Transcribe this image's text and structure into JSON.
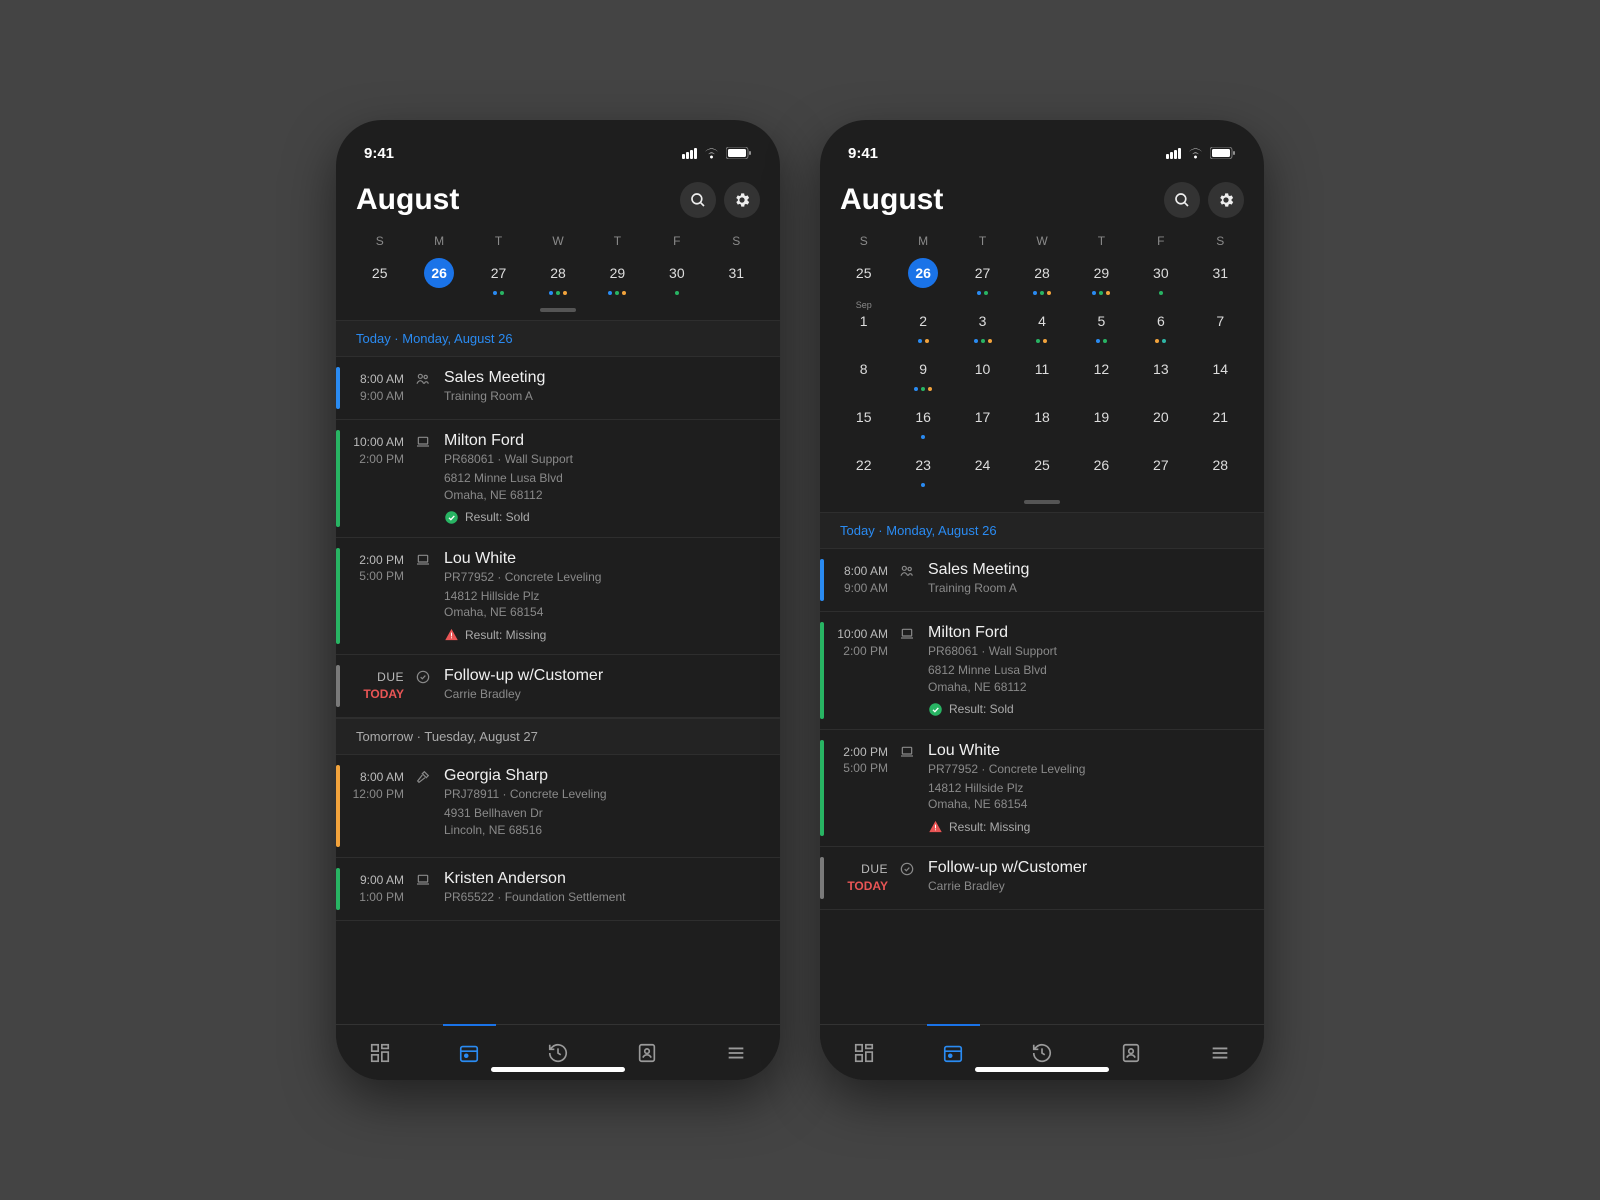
{
  "status": {
    "time": "9:41"
  },
  "header": {
    "title": "August"
  },
  "weekdays": [
    "S",
    "M",
    "T",
    "W",
    "T",
    "F",
    "S"
  ],
  "colors": {
    "blue": "#2a8bf2",
    "green": "#28b463",
    "orange": "#f2a33c",
    "teal": "#2fb6a6",
    "red": "#e95555",
    "gray": "#7a7a7a"
  },
  "weeks_left": [
    {
      "days": [
        {
          "n": "25"
        },
        {
          "n": "26",
          "selected": true
        },
        {
          "n": "27",
          "dots": [
            "blue",
            "green"
          ]
        },
        {
          "n": "28",
          "dots": [
            "blue",
            "green",
            "orange"
          ]
        },
        {
          "n": "29",
          "dots": [
            "blue",
            "green",
            "orange"
          ]
        },
        {
          "n": "30",
          "dots": [
            "green"
          ]
        },
        {
          "n": "31"
        }
      ]
    }
  ],
  "weeks_right": [
    {
      "days": [
        {
          "n": "25"
        },
        {
          "n": "26",
          "selected": true
        },
        {
          "n": "27",
          "dots": [
            "blue",
            "green"
          ]
        },
        {
          "n": "28",
          "dots": [
            "blue",
            "green",
            "orange"
          ]
        },
        {
          "n": "29",
          "dots": [
            "blue",
            "green",
            "orange"
          ]
        },
        {
          "n": "30",
          "dots": [
            "green"
          ]
        },
        {
          "n": "31"
        }
      ]
    },
    {
      "days": [
        {
          "n": "1",
          "month_label": "Sep"
        },
        {
          "n": "2",
          "dots": [
            "blue",
            "orange"
          ]
        },
        {
          "n": "3",
          "dots": [
            "blue",
            "green",
            "orange"
          ]
        },
        {
          "n": "4",
          "dots": [
            "green",
            "orange"
          ]
        },
        {
          "n": "5",
          "dots": [
            "blue",
            "green"
          ]
        },
        {
          "n": "6",
          "dots": [
            "orange",
            "teal"
          ]
        },
        {
          "n": "7"
        }
      ]
    },
    {
      "days": [
        {
          "n": "8"
        },
        {
          "n": "9",
          "dots": [
            "blue",
            "green",
            "orange"
          ]
        },
        {
          "n": "10"
        },
        {
          "n": "11"
        },
        {
          "n": "12"
        },
        {
          "n": "13"
        },
        {
          "n": "14"
        }
      ]
    },
    {
      "days": [
        {
          "n": "15"
        },
        {
          "n": "16",
          "dots": [
            "blue"
          ]
        },
        {
          "n": "17"
        },
        {
          "n": "18"
        },
        {
          "n": "19"
        },
        {
          "n": "20"
        },
        {
          "n": "21"
        }
      ]
    },
    {
      "days": [
        {
          "n": "22"
        },
        {
          "n": "23",
          "dots": [
            "blue"
          ]
        },
        {
          "n": "24"
        },
        {
          "n": "25"
        },
        {
          "n": "26"
        },
        {
          "n": "27"
        },
        {
          "n": "28"
        }
      ]
    }
  ],
  "sections": {
    "today_header": "Today · Monday, August 26",
    "tomorrow_header": "Tomorrow · Tuesday, August 27"
  },
  "events_today": [
    {
      "bar": "blue",
      "t1": "8:00 AM",
      "t2": "9:00 AM",
      "icon": "people",
      "title": "Sales Meeting",
      "sub": "Training Room A"
    },
    {
      "bar": "green",
      "t1": "10:00 AM",
      "t2": "2:00 PM",
      "icon": "laptop",
      "title": "Milton Ford",
      "sub": "PR68061 · Wall Support",
      "addr1": "6812 Minne Lusa Blvd",
      "addr2": "Omaha, NE 68112",
      "result": {
        "icon": "check",
        "text": "Result: Sold"
      }
    },
    {
      "bar": "green",
      "t1": "2:00 PM",
      "t2": "5:00 PM",
      "icon": "laptop",
      "title": "Lou White",
      "sub": "PR77952 · Concrete Leveling",
      "addr1": "14812 Hillside Plz",
      "addr2": "Omaha, NE 68154",
      "result": {
        "icon": "alert",
        "text": "Result: Missing"
      }
    },
    {
      "bar": "gray",
      "due": "DUE",
      "today": "TODAY",
      "icon": "task",
      "title": "Follow-up w/Customer",
      "sub": "Carrie Bradley"
    }
  ],
  "events_tomorrow": [
    {
      "bar": "orange",
      "t1": "8:00 AM",
      "t2": "12:00 PM",
      "icon": "hammer",
      "title": "Georgia Sharp",
      "sub": "PRJ78911 · Concrete Leveling",
      "addr1": "4931 Bellhaven Dr",
      "addr2": "Lincoln, NE 68516"
    },
    {
      "bar": "green",
      "t1": "9:00 AM",
      "t2": "1:00 PM",
      "icon": "laptop",
      "title": "Kristen Anderson",
      "sub": "PR65522 · Foundation Settlement"
    }
  ]
}
